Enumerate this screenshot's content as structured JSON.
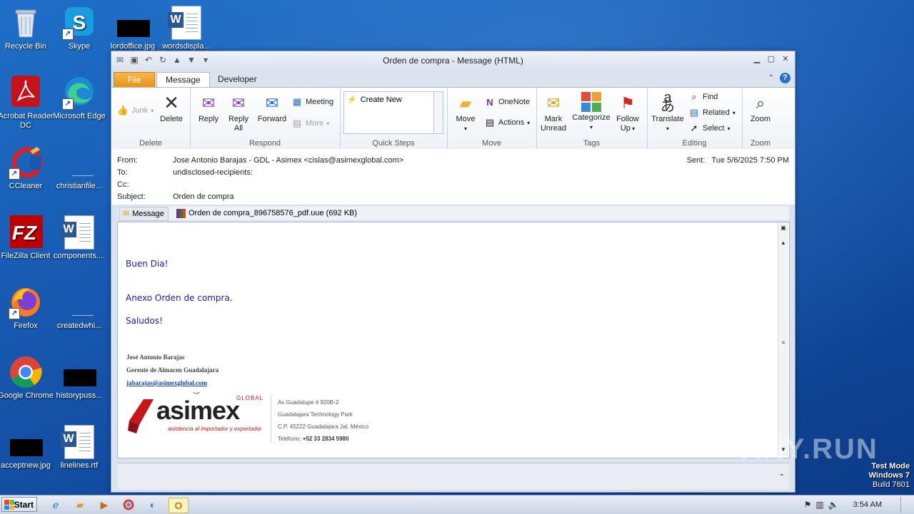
{
  "desktop": {
    "icons": [
      {
        "label": "Recycle Bin"
      },
      {
        "label": "Skype"
      },
      {
        "label": "lordoffice.jpg"
      },
      {
        "label": "wordsdispla..."
      },
      {
        "label": "Acrobat Reader DC"
      },
      {
        "label": "Microsoft Edge"
      },
      {
        "label": "CCleaner"
      },
      {
        "label": "christianfile..."
      },
      {
        "label": "FileZilla Client"
      },
      {
        "label": "components...."
      },
      {
        "label": "Firefox"
      },
      {
        "label": "createdwhi..."
      },
      {
        "label": "Google Chrome"
      },
      {
        "label": "historypuss..."
      },
      {
        "label": "acceptnew.jpg"
      },
      {
        "label": "linelines.rtf"
      }
    ],
    "test_mode": {
      "line1": "Test Mode",
      "line2": "Windows 7",
      "line3": "Build 7601"
    },
    "watermark": "ANY.RUN"
  },
  "window": {
    "title": "Orden de compra - Message (HTML)",
    "tabs": [
      {
        "label": "File"
      },
      {
        "label": "Message"
      },
      {
        "label": "Developer"
      }
    ],
    "ribbon": {
      "delete_group": {
        "label": "Delete",
        "junk": "Junk",
        "delete": "Delete"
      },
      "respond_group": {
        "label": "Respond",
        "reply": "Reply",
        "reply_all_1": "Reply",
        "reply_all_2": "All",
        "forward": "Forward",
        "meeting": "Meeting",
        "more": "More"
      },
      "quick_steps_group": {
        "label": "Quick Steps",
        "create_new": "Create New"
      },
      "move_group": {
        "label": "Move",
        "move": "Move",
        "onenote": "OneNote",
        "actions": "Actions"
      },
      "tags_group": {
        "label": "Tags",
        "mark_unread_1": "Mark",
        "mark_unread_2": "Unread",
        "categorize": "Categorize",
        "follow_up_1": "Follow",
        "follow_up_2": "Up"
      },
      "editing_group": {
        "label": "Editing",
        "translate": "Translate",
        "find": "Find",
        "related": "Related",
        "select": "Select"
      },
      "zoom_group": {
        "label": "Zoom",
        "zoom": "Zoom"
      }
    }
  },
  "message": {
    "from_label": "From:",
    "from": "Jose Antonio Barajas - GDL - Asimex <cislas@asimexglobal.com>",
    "to_label": "To:",
    "to": "undisclosed-recipients:",
    "cc_label": "Cc:",
    "cc": "",
    "subject_label": "Subject:",
    "subject": "Orden de compra",
    "sent_label": "Sent:",
    "sent": "Tue 5/6/2025 7:50 PM",
    "tab_message": "Message",
    "attachment": "Orden de compra_896758576_pdf.uue (692 KB)",
    "body": {
      "line1": "Buen Dia!",
      "line2": "Anexo Orden de compra.",
      "line3": "Saludos!"
    },
    "signature": {
      "name": "José Antonio Barajas",
      "title": "Gerente de Almacen Guadalajara",
      "email": "jabarajas@asimexglobal.com",
      "logo_text": "asimex",
      "logo_global": "GLOBAL",
      "logo_tagline": "asistencia al importador y exportador",
      "addr1": "Av Guadalupe # 920B-2",
      "addr2": "Guadalajara Technology Park",
      "addr3": "C.P. 45222 Guadalajara Jal. México",
      "phone_label": "Teléfono:",
      "phone": "+52 33 2834 5980"
    }
  },
  "taskbar": {
    "start": "Start",
    "clock": "3:54 AM"
  }
}
